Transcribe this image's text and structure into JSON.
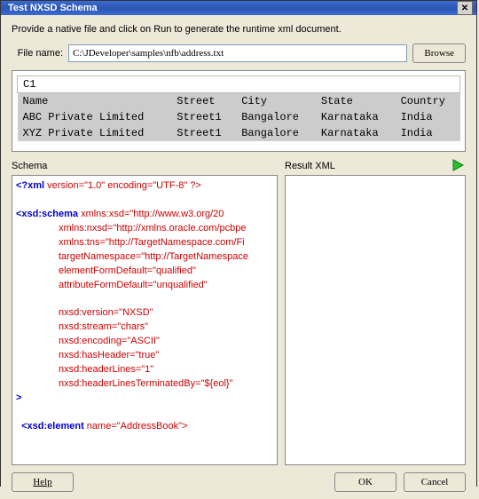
{
  "window": {
    "title": "Test NXSD Schema"
  },
  "desc": "Provide a native file and click on Run to generate the runtime xml document.",
  "file": {
    "label": "File name:",
    "value": "C:\\JDeveloper\\samples\\nfb\\address.txt",
    "browse": "Browse"
  },
  "preview": {
    "c1": "C1",
    "headers": [
      "Name",
      "Street",
      "City",
      "State",
      "Country"
    ],
    "rows": [
      [
        "ABC Private Limited",
        "Street1",
        "Bangalore",
        "Karnataka",
        "India"
      ],
      [
        "XYZ Private Limited",
        "Street1",
        "Bangalore",
        "Karnataka",
        "India"
      ]
    ]
  },
  "labels": {
    "schema": "Schema",
    "result": "Result XML"
  },
  "schema": {
    "decl_open": "<?xml",
    "decl_attrs": " version=\"1.0\" encoding=\"UTF-8\" ?>",
    "schema_open": "<xsd:schema",
    "a_xsd": "xmlns:xsd=\"http://www.w3.org/20",
    "a_nxsd": "xmlns:nxsd=\"http://xmlns.oracle.com/pcbpe",
    "a_tns": "xmlns:tns=\"http://TargetNamespace.com/Fi",
    "a_targ": "targetNamespace=\"http://TargetNamespace",
    "a_efd": "elementFormDefault=\"qualified\"",
    "a_afd": "attributeFormDefault=\"unqualified\"",
    "a_ver": "nxsd:version=\"NXSD\"",
    "a_stream": "nxsd:stream=\"chars\"",
    "a_enc": "nxsd:encoding=\"ASCII\"",
    "a_hash": "nxsd:hasHeader=\"true\"",
    "a_hl": "nxsd:headerLines=\"1\"",
    "a_hlt": "nxsd:headerLinesTerminatedBy=\"${eol}\"",
    "close": ">",
    "elem_open": "<xsd:element",
    "elem_attr": " name=\"AddressBook\">"
  },
  "buttons": {
    "help": "Help",
    "ok": "OK",
    "cancel": "Cancel"
  }
}
